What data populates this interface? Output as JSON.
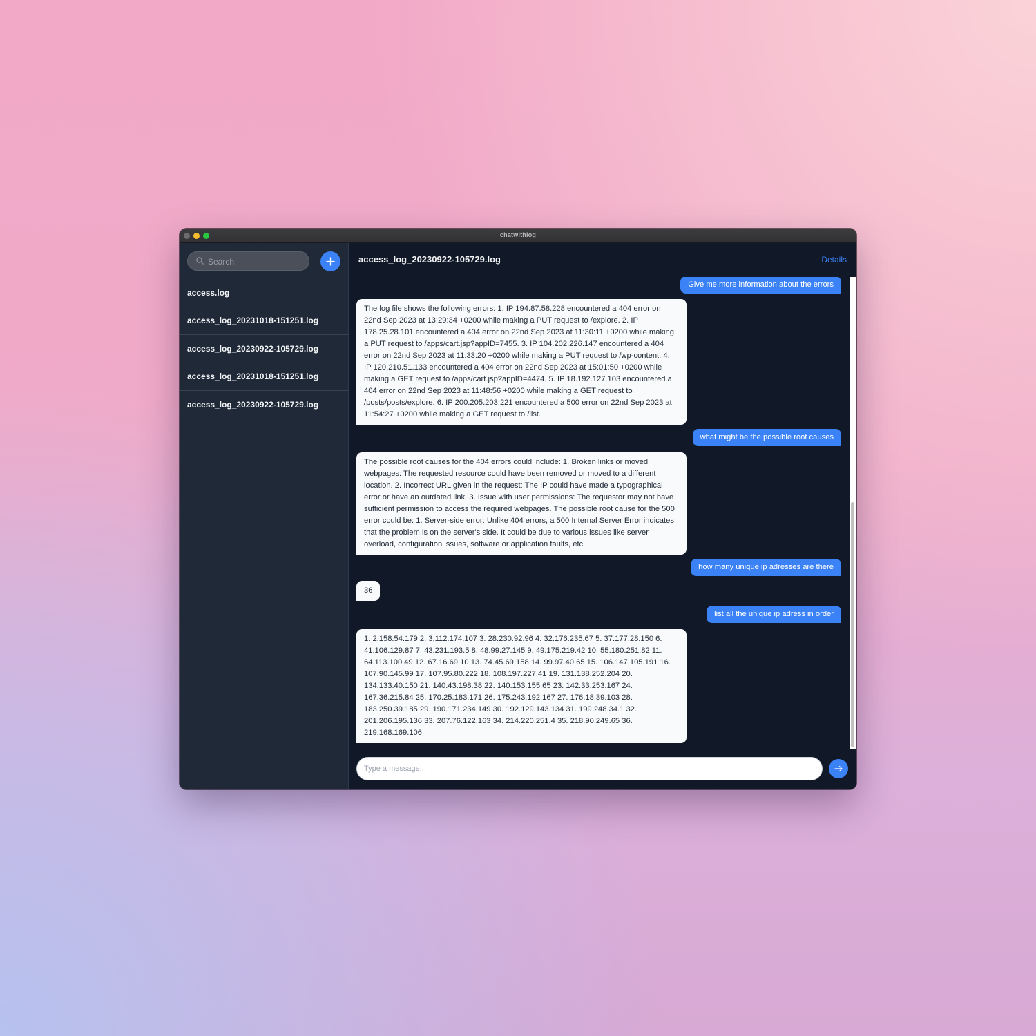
{
  "window": {
    "title": "chatwithlog"
  },
  "sidebar": {
    "search_placeholder": "Search",
    "files": [
      "access.log",
      "access_log_20231018-151251.log",
      "access_log_20230922-105729.log",
      "access_log_20231018-151251.log",
      "access_log_20230922-105729.log"
    ]
  },
  "chat": {
    "title": "access_log_20230922-105729.log",
    "details_label": "Details",
    "messages": [
      {
        "role": "user",
        "text": "Give me more information about the errors"
      },
      {
        "role": "assistant",
        "text": "The log file shows the following errors: 1. IP 194.87.58.228 encountered a 404 error on 22nd Sep 2023 at 13:29:34 +0200 while making a PUT request to /explore. 2. IP 178.25.28.101 encountered a 404 error on 22nd Sep 2023 at 11:30:11 +0200 while making a PUT request to /apps/cart.jsp?appID=7455. 3. IP 104.202.226.147 encountered a 404 error on 22nd Sep 2023 at 11:33:20 +0200 while making a PUT request to /wp-content. 4. IP 120.210.51.133 encountered a 404 error on 22nd Sep 2023 at 15:01:50 +0200 while making a GET request to /apps/cart.jsp?appID=4474. 5. IP 18.192.127.103 encountered a 404 error on 22nd Sep 2023 at 11:48:56 +0200 while making a GET request to /posts/posts/explore. 6. IP 200.205.203.221 encountered a 500 error on 22nd Sep 2023 at 11:54:27 +0200 while making a GET request to /list."
      },
      {
        "role": "user",
        "text": "what might be the possible root causes"
      },
      {
        "role": "assistant",
        "text": "The possible root causes for the 404 errors could include: 1. Broken links or moved webpages: The requested resource could have been removed or moved to a different location. 2. Incorrect URL given in the request: The IP could have made a typographical error or have an outdated link. 3. Issue with user permissions: The requestor may not have sufficient permission to access the required webpages. The possible root cause for the 500 error could be: 1. Server-side error: Unlike 404 errors, a 500 Internal Server Error indicates that the problem is on the server's side. It could be due to various issues like server overload, configuration issues, software or application faults, etc."
      },
      {
        "role": "user",
        "text": "how many unique ip adresses are there"
      },
      {
        "role": "assistant",
        "text": "36"
      },
      {
        "role": "user",
        "text": "list all the unique ip adress in order"
      },
      {
        "role": "assistant",
        "text": "1. 2.158.54.179 2. 3.112.174.107 3. 28.230.92.96 4. 32.176.235.67 5. 37.177.28.150 6. 41.106.129.87 7. 43.231.193.5 8. 48.99.27.145 9. 49.175.219.42 10. 55.180.251.82 11. 64.113.100.49 12. 67.16.69.10 13. 74.45.69.158 14. 99.97.40.65 15. 106.147.105.191 16. 107.90.145.99 17. 107.95.80.222 18. 108.197.227.41 19. 131.138.252.204 20. 134.133.40.150 21. 140.43.198.38 22. 140.153.155.65 23. 142.33.253.167 24. 167.36.215.84 25. 170.25.183.171 26. 175.243.192.167 27. 176.18.39.103 28. 183.250.39.185 29. 190.171.234.149 30. 192.129.143.134 31. 199.248.34.1 32. 201.206.195.136 33. 207.76.122.163 34. 214.220.251.4 35. 218.90.249.65 36. 219.168.169.106"
      }
    ],
    "input_placeholder": "Type a message..."
  },
  "colors": {
    "accent": "#3b82f6",
    "sidebar_bg": "#1f2937",
    "chat_bg": "#111827",
    "bubble_bg": "#f9fafb"
  },
  "icons": {
    "search": "search-icon",
    "new_chat": "plus-icon",
    "send": "arrow-right-icon"
  }
}
